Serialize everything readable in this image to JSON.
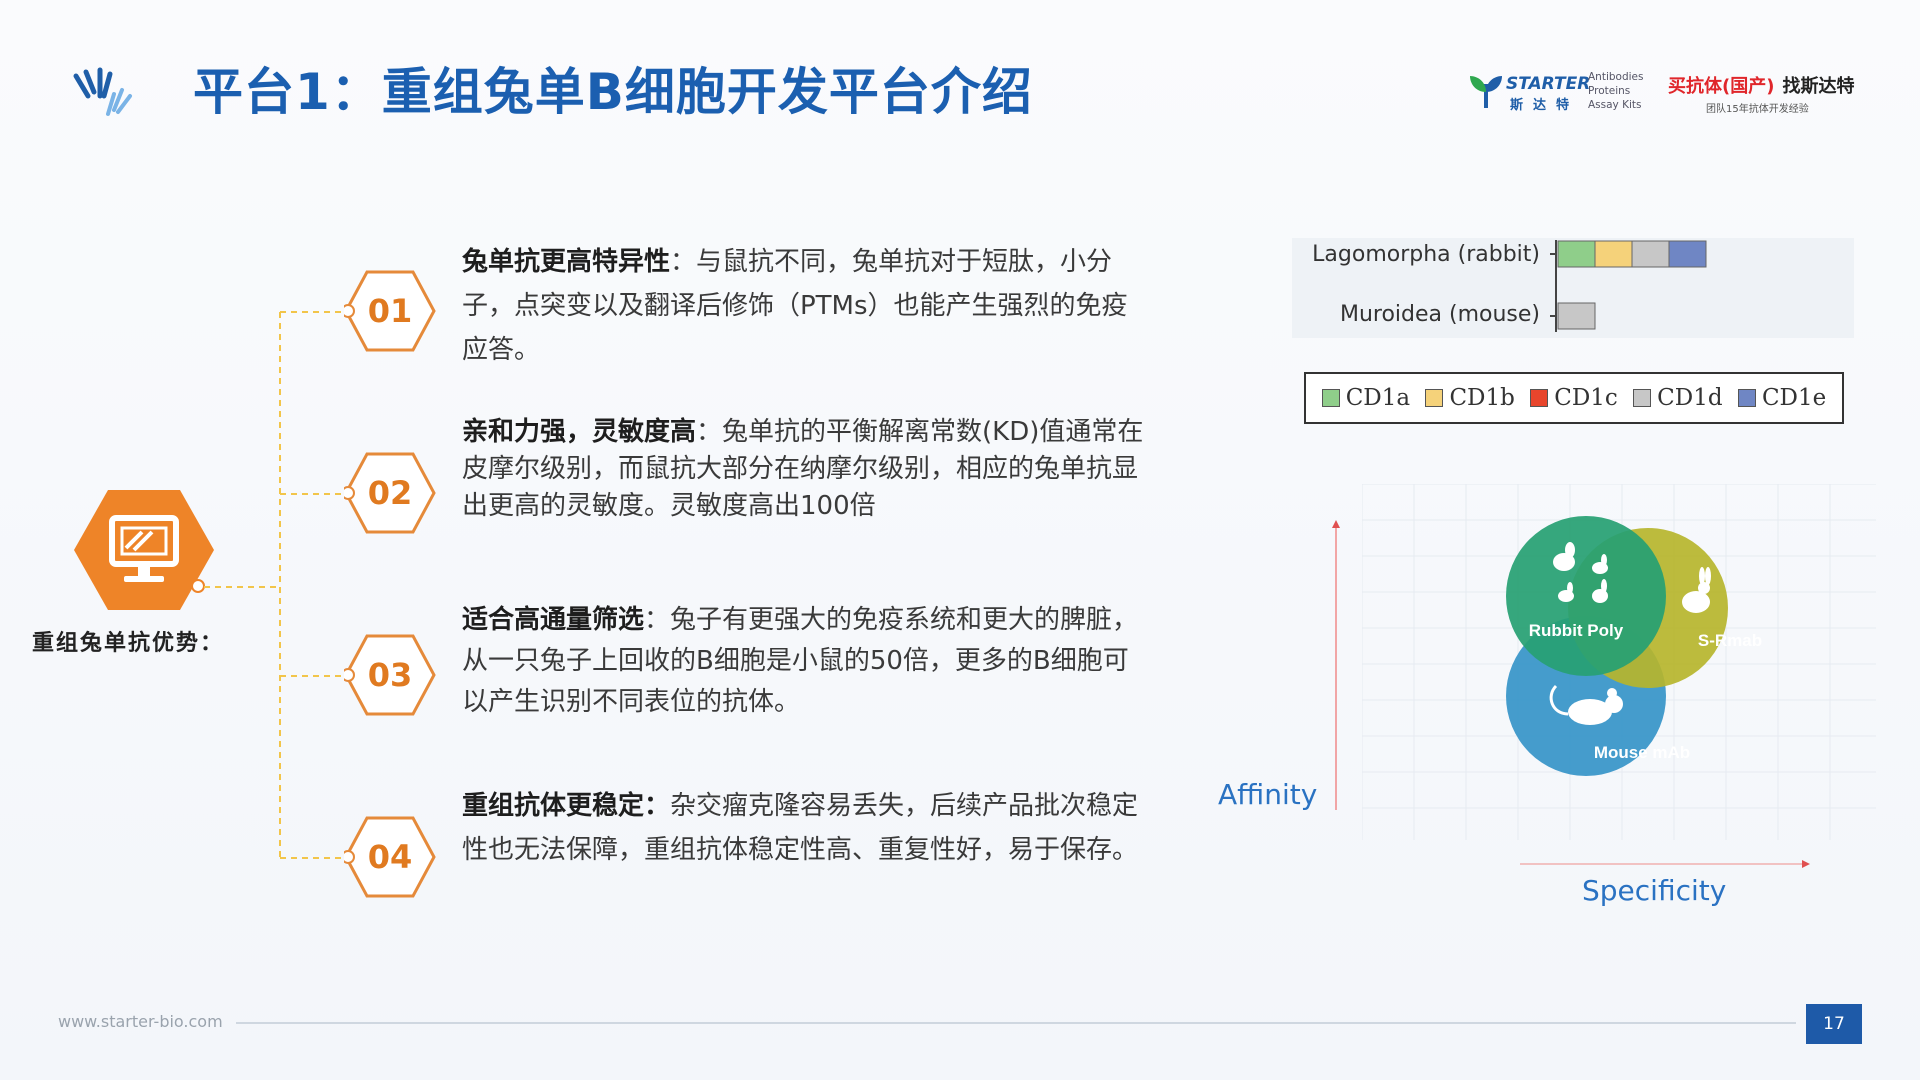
{
  "header": {
    "title": "平台1：重组兔单B细胞开发平台介绍",
    "brand": {
      "name": "STARTER",
      "name_cn": "斯达特",
      "lines": [
        "Antibodies",
        "Proteins",
        "Assay Kits"
      ],
      "slogan_red": "买抗体(国产)",
      "slogan_dark": "找斯达特",
      "sub": "团队15年抗体开发经验"
    }
  },
  "left": {
    "label": "重组兔单抗优势："
  },
  "items": [
    {
      "num": "01",
      "heading": "兔单抗更高特异性",
      "sep": "：",
      "body": "与鼠抗不同，兔单抗对于短肽，小分子，点突变以及翻译后修饰（PTMs）也能产生强烈的免疫应答。"
    },
    {
      "num": "02",
      "heading": "亲和力强，灵敏度高",
      "sep": "：",
      "body": "兔单抗的平衡解离常数(KD)值通常在皮摩尔级别，而鼠抗大部分在纳摩尔级别，相应的兔单抗显出更高的灵敏度。灵敏度高出100倍"
    },
    {
      "num": "03",
      "heading": "适合高通量筛选",
      "sep": "：",
      "body": "兔子有更强大的免疫系统和更大的脾脏，从一只兔子上回收的B细胞是小鼠的50倍，更多的B细胞可以产生识别不同表位的抗体。"
    },
    {
      "num": "04",
      "heading": "重组抗体更稳定：",
      "sep": "",
      "body": "杂交瘤克隆容易丢失，后续产品批次稳定性也无法保障，重组抗体稳定性高、重复性好，易于保存。"
    }
  ],
  "chart_data": {
    "type": "bar",
    "orientation": "horizontal",
    "stacked": true,
    "categories": [
      "Lagomorpha (rabbit)",
      "Muroidea (mouse)"
    ],
    "series": [
      {
        "name": "CD1a",
        "color": "#8fce8a",
        "values": [
          1,
          0
        ]
      },
      {
        "name": "CD1b",
        "color": "#f5d27a",
        "values": [
          1,
          0
        ]
      },
      {
        "name": "CD1c",
        "color": "#e8452c",
        "values": [
          0,
          0
        ]
      },
      {
        "name": "CD1d",
        "color": "#c7c7c7",
        "values": [
          1,
          1
        ]
      },
      {
        "name": "CD1e",
        "color": "#6f86c4",
        "values": [
          1,
          0
        ]
      }
    ],
    "legend": "bottom",
    "grid": false
  },
  "venn": {
    "circles": [
      {
        "label": "Rubbit Poly",
        "color": "#27a073"
      },
      {
        "label": "S-Rmab",
        "color": "#b6b52c"
      },
      {
        "label": "Mouse mAb",
        "color": "#3b97c9"
      }
    ],
    "x_label": "Specificity",
    "y_label": "Affinity"
  },
  "footer": {
    "url": "www.starter-bio.com",
    "page": "17"
  }
}
